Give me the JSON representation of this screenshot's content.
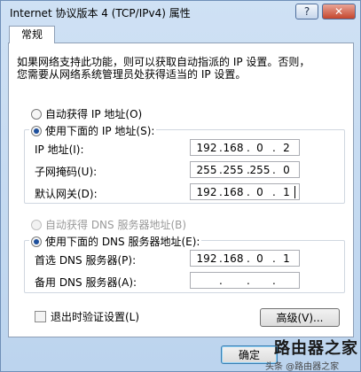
{
  "window": {
    "title": "Internet 协议版本 4 (TCP/IPv4) 属性",
    "help_label": "?",
    "close_label": "✕"
  },
  "tab": {
    "label": "常规"
  },
  "description": {
    "line1": "如果网络支持此功能，则可以获取自动指派的 IP 设置。否则，",
    "line2": "您需要从网络系统管理员处获得适当的 IP 设置。"
  },
  "ip_section": {
    "auto_label": "自动获得 IP 地址(O)",
    "manual_label": "使用下面的 IP 地址(S):",
    "selected": "manual",
    "fields": [
      {
        "label": "IP 地址(I):",
        "octets": [
          "192",
          "168",
          "0",
          "2"
        ]
      },
      {
        "label": "子网掩码(U):",
        "octets": [
          "255",
          "255",
          "255",
          "0"
        ]
      },
      {
        "label": "默认网关(D):",
        "octets": [
          "192",
          "168",
          "0",
          "1"
        ]
      }
    ]
  },
  "dns_section": {
    "auto_label": "自动获得 DNS 服务器地址(B)",
    "manual_label": "使用下面的 DNS 服务器地址(E):",
    "selected": "manual",
    "fields": [
      {
        "label": "首选 DNS 服务器(P):",
        "octets": [
          "192",
          "168",
          "0",
          "1"
        ]
      },
      {
        "label": "备用 DNS 服务器(A):",
        "octets": [
          "",
          "",
          "",
          ""
        ]
      }
    ]
  },
  "validate": {
    "label": "退出时验证设置(L)",
    "checked": false
  },
  "buttons": {
    "advanced": "高级(V)...",
    "ok": "确定"
  },
  "watermark": {
    "main": "路由器之家",
    "sub": "头条 @路由器之家"
  },
  "colors": {
    "accent": "#1d4f9c",
    "title_bar": "#cfe1f4",
    "close": "#c4462e"
  }
}
